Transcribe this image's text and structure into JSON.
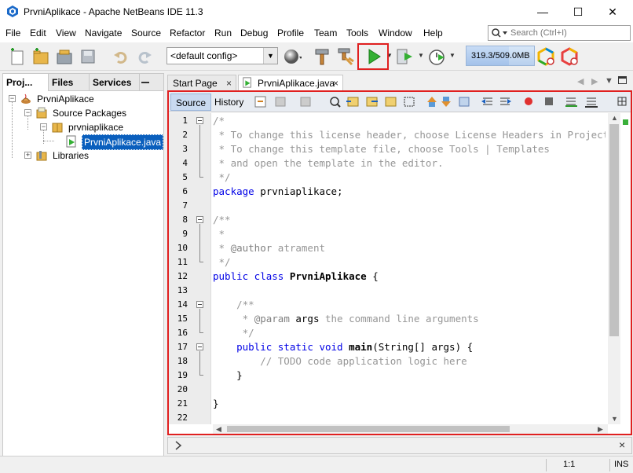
{
  "window": {
    "title": "PrvniAplikace - Apache NetBeans IDE 11.3"
  },
  "menu": [
    "File",
    "Edit",
    "View",
    "Navigate",
    "Source",
    "Refactor",
    "Run",
    "Debug",
    "Profile",
    "Team",
    "Tools",
    "Window",
    "Help"
  ],
  "search": {
    "placeholder": "Search (Ctrl+I)"
  },
  "toolbar": {
    "config_value": "<default config>",
    "memory": "319.3/509.0MB",
    "memory_fraction": 0.63
  },
  "left_panel": {
    "tabs": [
      "Proj...",
      "Files",
      "Services"
    ],
    "tree": {
      "project": "PrvniAplikace",
      "source_packages": "Source Packages",
      "package": "prvniaplikace",
      "file": "PrvniAplikace.java",
      "libraries": "Libraries"
    }
  },
  "editor": {
    "tabs": [
      "Start Page",
      "PrvniAplikace.java"
    ],
    "modes": [
      "Source",
      "History"
    ],
    "line_numbers": [
      "1",
      "2",
      "3",
      "4",
      "5",
      "6",
      "7",
      "8",
      "9",
      "10",
      "11",
      "12",
      "13",
      "14",
      "15",
      "16",
      "17",
      "18",
      "19",
      "20",
      "21",
      "22"
    ],
    "code": {
      "l1": "/*",
      "l2": " * To change this license header, choose License Headers in Project Properties.",
      "l3": " * To change this template file, choose Tools | Templates",
      "l4": " * and open the template in the editor.",
      "l5": " */",
      "l6_kw": "package",
      "l6_rest": " prvniaplikace;",
      "l8": "/**",
      "l9": " *",
      "l10_pre": " * ",
      "l10_tag": "@author",
      "l10_rest": " atrament",
      "l11": " */",
      "l12_kw": "public class",
      "l12_name": " PrvniAplikace",
      "l12_rest": " {",
      "l14": "    /**",
      "l15_pre": "     * ",
      "l15_tag": "@param",
      "l15_arg": " args",
      "l15_rest": " the command line arguments",
      "l16": "     */",
      "l17_kw": "    public static void",
      "l17_name": " main",
      "l17_rest": "(String[] args) {",
      "l18": "        // TODO code application logic here",
      "l19": "    }",
      "l21": "}"
    }
  },
  "status": {
    "position": "1:1",
    "mode": "INS"
  }
}
